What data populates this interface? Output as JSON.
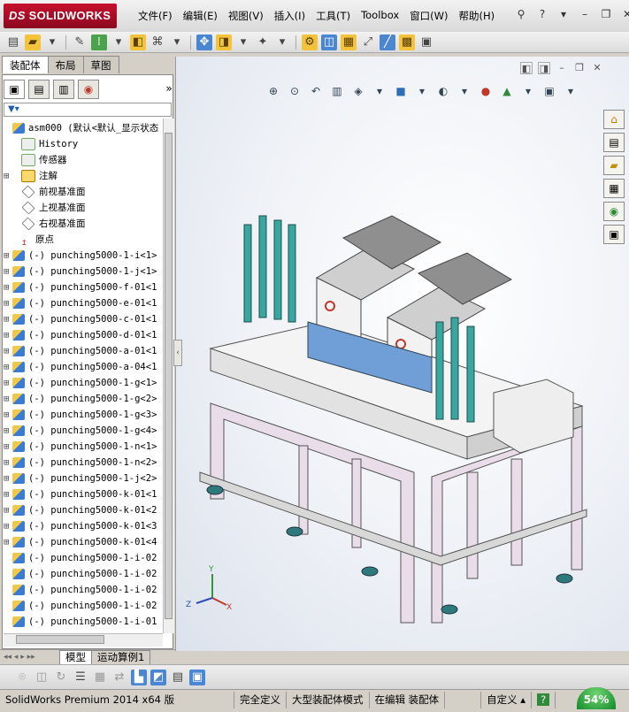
{
  "app": {
    "logo_text": "SOLIDWORKS"
  },
  "menu": [
    "文件(F)",
    "编辑(E)",
    "视图(V)",
    "插入(I)",
    "工具(T)",
    "Toolbox",
    "窗口(W)",
    "帮助(H)"
  ],
  "left_tabs": [
    "装配体",
    "布局",
    "草图"
  ],
  "tree": {
    "root": "asm000  (默认<默认_显示状态",
    "items": [
      {
        "label": "History",
        "icon": "history-icon"
      },
      {
        "label": "传感器",
        "icon": "sensor-icon"
      },
      {
        "label": "注解",
        "icon": "annotation-icon"
      },
      {
        "label": "前视基准面",
        "icon": "plane-icon"
      },
      {
        "label": "上视基准面",
        "icon": "plane-icon"
      },
      {
        "label": "右视基准面",
        "icon": "plane-icon"
      },
      {
        "label": "原点",
        "icon": "origin-icon"
      },
      {
        "label": "(-) punching5000-1-i<1>"
      },
      {
        "label": "(-) punching5000-1-j<1>"
      },
      {
        "label": "(-) punching5000-f-01<1"
      },
      {
        "label": "(-) punching5000-e-01<1"
      },
      {
        "label": "(-) punching5000-c-01<1"
      },
      {
        "label": "(-) punching5000-d-01<1"
      },
      {
        "label": "(-) punching5000-a-01<1"
      },
      {
        "label": "(-) punching5000-a-04<1"
      },
      {
        "label": "(-) punching5000-1-g<1>"
      },
      {
        "label": "(-) punching5000-1-g<2>"
      },
      {
        "label": "(-) punching5000-1-g<3>"
      },
      {
        "label": "(-) punching5000-1-g<4>"
      },
      {
        "label": "(-) punching5000-1-n<1>"
      },
      {
        "label": "(-) punching5000-1-n<2>"
      },
      {
        "label": "(-) punching5000-1-j<2>"
      },
      {
        "label": "(-) punching5000-k-01<1"
      },
      {
        "label": "(-) punching5000-k-01<2"
      },
      {
        "label": "(-) punching5000-k-01<3"
      },
      {
        "label": "(-) punching5000-k-01<4"
      },
      {
        "label": "(-) punching5000-1-i-02"
      },
      {
        "label": "(-) punching5000-1-i-02"
      },
      {
        "label": "(-) punching5000-1-i-02"
      },
      {
        "label": "(-) punching5000-1-i-02"
      },
      {
        "label": "(-) punching5000-1-i-01"
      }
    ]
  },
  "bottom_tabs": [
    "模型",
    "运动算例1"
  ],
  "status": {
    "product": "SolidWorks Premium 2014 x64 版",
    "state1": "完全定义",
    "state2": "大型装配体模式",
    "state3": "在编辑 装配体",
    "custom": "自定义",
    "help_icon": "?",
    "zoom": "54%"
  },
  "triad": {
    "x": "X",
    "y": "Y",
    "z": "Z"
  }
}
